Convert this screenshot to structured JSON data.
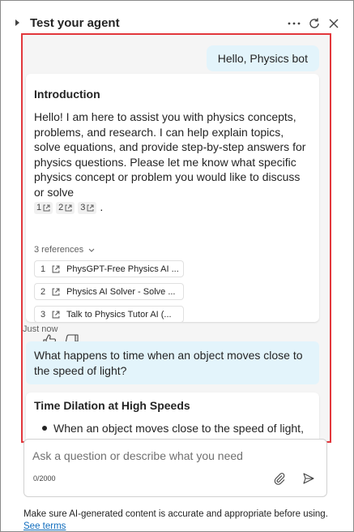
{
  "header": {
    "title": "Test your agent",
    "more_icon": "more-horizontal-icon",
    "refresh_icon": "refresh-icon",
    "close_icon": "close-icon"
  },
  "conversation": {
    "user_message_1": "Hello, Physics bot",
    "bot_reply_1": {
      "heading": "Introduction",
      "body": "Hello! I am here to assist you with physics concepts, problems, and research. I can help explain topics, solve equations, and provide step-by-step answers for physics questions. Please let me know what specific physics concept or problem you would like to discuss or solve",
      "citations": [
        "1",
        "2",
        "3"
      ],
      "period": ".",
      "references_label": "3 references",
      "references": [
        {
          "num": "1",
          "title": "PhysGPT-Free Physics AI ..."
        },
        {
          "num": "2",
          "title": "Physics AI Solver - Solve ..."
        },
        {
          "num": "3",
          "title": "Talk to Physics Tutor AI (..."
        }
      ]
    },
    "timestamp": "Just now",
    "user_message_2": "What happens to time when an object moves close to the speed of light?",
    "bot_reply_2": {
      "heading": "Time Dilation at High Speeds",
      "bullet_1": "When an object moves close to the speed of light,"
    }
  },
  "composer": {
    "placeholder": "Ask a question or describe what you need",
    "char_count": "0/2000"
  },
  "footer": {
    "disclaimer": "Make sure AI-generated content is accurate and appropriate before using.",
    "link": "See terms"
  },
  "colors": {
    "highlight_border": "#e2373c",
    "user_bubble": "#e3f4fb",
    "link": "#0f6cbd"
  }
}
